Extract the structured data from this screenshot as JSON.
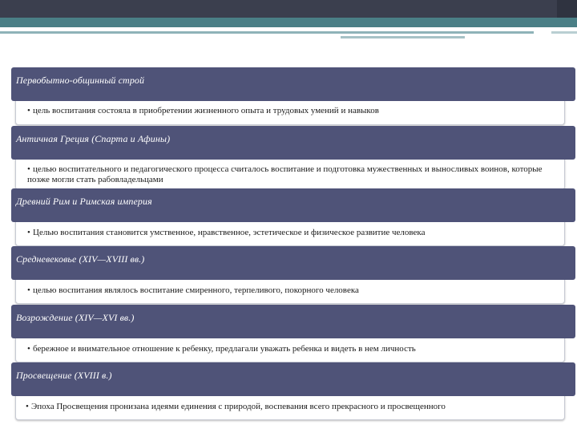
{
  "colors": {
    "header_bg": "#4f5378",
    "top_bar": "#3b3f4e",
    "teal_band": "#4a7f86"
  },
  "sections": [
    {
      "header": "Первобытно-общинный строй",
      "detail": "цель воспитания состояла в приобретении жизненного опыта и трудовых умений и навыков"
    },
    {
      "header": "Античная Греция (Спарта и Афины)",
      "detail": "целью воспитательного и педагогического процесса считалось воспитание и подготовка мужественных и выносливых воинов, которые позже могли стать рабовладельцами"
    },
    {
      "header": "Древний Рим и Римская империя",
      "detail": "Целью воспитания становится умственное, нравственное, эстетическое и физическое развитие человека"
    },
    {
      "header": "Средневековье (XIV—XVIII вв.)",
      "detail": "целью воспитания являлось воспитание смиренного, терпеливого, покорного человека"
    },
    {
      "header": "Возрождение (XIV—XVI вв.)",
      "detail": "бережное и внимательное отношение к ребенку, предлагали уважать ребенка и видеть в нем личность"
    },
    {
      "header": "Просвещение (XVIII в.)",
      "detail": "Эпоха Просвещения пронизана идеями единения с природой, воспевания всего прекрасного и просвещенного"
    }
  ]
}
